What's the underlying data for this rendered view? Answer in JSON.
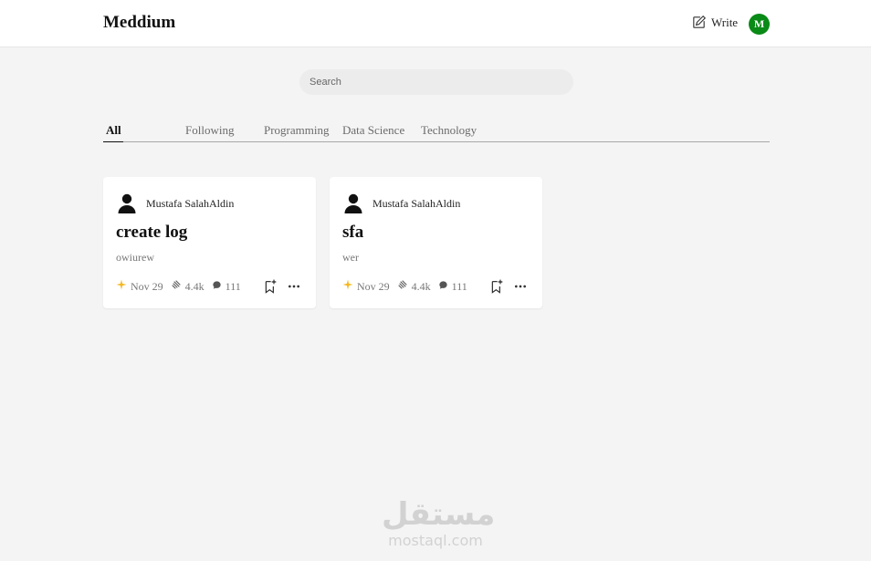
{
  "header": {
    "logo": "Meddium",
    "write_label": "Write",
    "write_icon": "edit-icon",
    "avatar_initial": "M",
    "avatar_color": "#0a8a16"
  },
  "search": {
    "placeholder": "Search",
    "value": ""
  },
  "tabs": [
    {
      "label": "All",
      "active": true
    },
    {
      "label": "Following",
      "active": false
    },
    {
      "label": "Programming",
      "active": false
    },
    {
      "label": "Data Science",
      "active": false
    },
    {
      "label": "Technology",
      "active": false
    }
  ],
  "posts": [
    {
      "author": "Mustafa SalahAldin",
      "title": "create log",
      "subtitle": "owiurew",
      "date": "Nov 29",
      "claps": "4.4k",
      "comments": "111"
    },
    {
      "author": "Mustafa SalahAldin",
      "title": "sfa",
      "subtitle": "wer",
      "date": "Nov 29",
      "claps": "4.4k",
      "comments": "111"
    }
  ],
  "watermark": {
    "arabic": "مستقل",
    "latin": "mostaql.com"
  },
  "colors": {
    "star": "#f5b921",
    "accent": "#0a8a16"
  }
}
